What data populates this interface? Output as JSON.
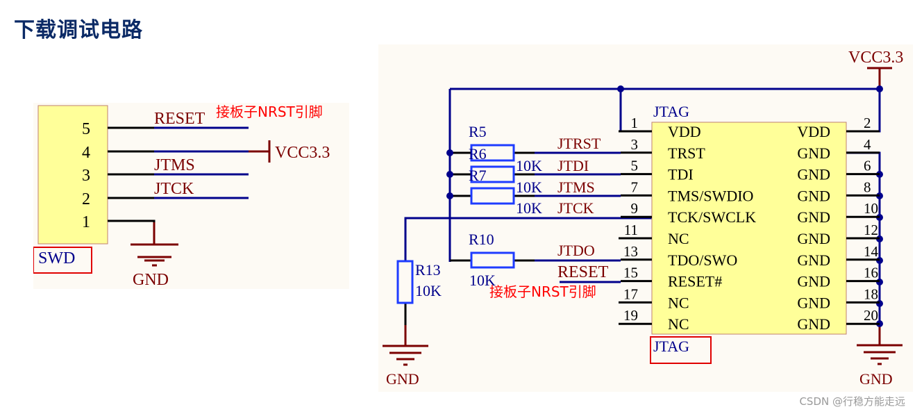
{
  "page": {
    "title": "下载调试电路",
    "watermark": "CSDN @行稳方能走远"
  },
  "colors": {
    "title": "#0b2a66",
    "wire": "#00008b",
    "power": "#7b0000",
    "pin": "#000000",
    "component_fill": "#ffff99",
    "annotation": "#ff0000",
    "resistor": "#1e3cff"
  },
  "swd": {
    "designator": "SWD",
    "pins": [
      "5",
      "4",
      "3",
      "2",
      "1"
    ],
    "nets": {
      "pin5": "RESET",
      "pin4": "VCC3.3",
      "pin3": "JTMS",
      "pin2": "JTCK",
      "pin1": "GND"
    },
    "reset_note": "接板子NRST引脚",
    "vcc_label": "VCC3.3",
    "gnd_label": "GND"
  },
  "jtag": {
    "header_label": "JTAG",
    "designator": "JTAG",
    "vcc_label": "VCC3.3",
    "gnd_right_label": "GND",
    "gnd_left_label": "GND",
    "reset_note": "接板子NRST引脚",
    "left_pins": [
      {
        "num": "1",
        "name": "VDD",
        "net": ""
      },
      {
        "num": "3",
        "name": "TRST",
        "net": "JTRST"
      },
      {
        "num": "5",
        "name": "TDI",
        "net": "JTDI"
      },
      {
        "num": "7",
        "name": "TMS/SWDIO",
        "net": "JTMS"
      },
      {
        "num": "9",
        "name": "TCK/SWCLK",
        "net": "JTCK"
      },
      {
        "num": "11",
        "name": "NC",
        "net": ""
      },
      {
        "num": "13",
        "name": "TDO/SWO",
        "net": "JTDO"
      },
      {
        "num": "15",
        "name": "RESET#",
        "net": "RESET"
      },
      {
        "num": "17",
        "name": "NC",
        "net": ""
      },
      {
        "num": "19",
        "name": "NC",
        "net": ""
      }
    ],
    "right_pins": [
      {
        "num": "2",
        "name": "VDD"
      },
      {
        "num": "4",
        "name": "GND"
      },
      {
        "num": "6",
        "name": "GND"
      },
      {
        "num": "8",
        "name": "GND"
      },
      {
        "num": "10",
        "name": "GND"
      },
      {
        "num": "12",
        "name": "GND"
      },
      {
        "num": "14",
        "name": "GND"
      },
      {
        "num": "16",
        "name": "GND"
      },
      {
        "num": "18",
        "name": "GND"
      },
      {
        "num": "20",
        "name": "GND"
      }
    ],
    "resistors": {
      "r5": {
        "ref": "R5",
        "value": "10K"
      },
      "r6": {
        "ref": "R6",
        "value": "10K"
      },
      "r7": {
        "ref": "R7",
        "value": "10K"
      },
      "r10": {
        "ref": "R10",
        "value": "10K"
      },
      "r13": {
        "ref": "R13",
        "value": "10K"
      }
    }
  }
}
